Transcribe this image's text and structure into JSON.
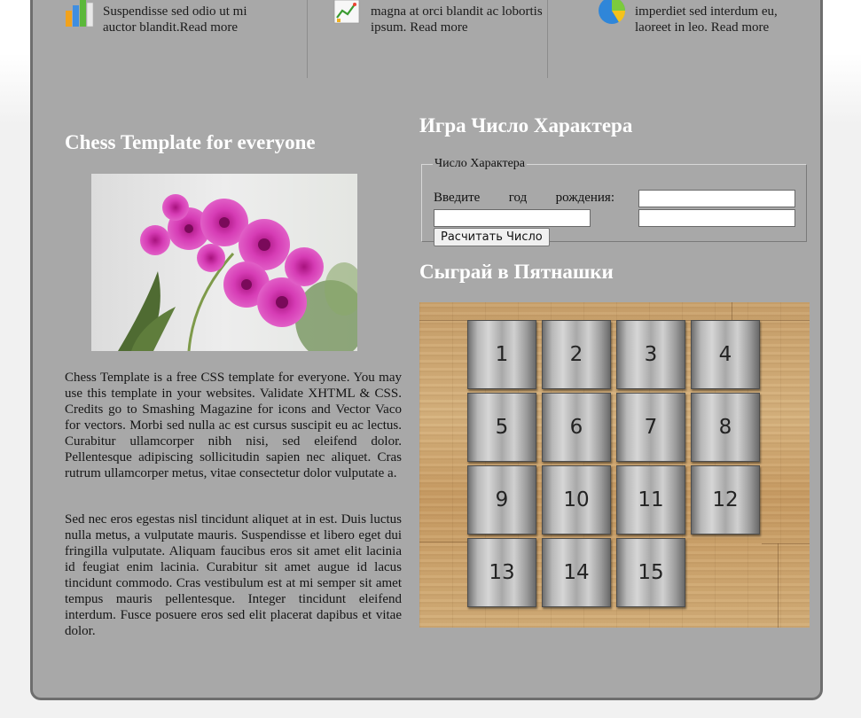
{
  "features": [
    {
      "icon": "bar-chart-icon",
      "text": "Suspendisse sed odio ut mi auctor blandit.",
      "more": "Read more"
    },
    {
      "icon": "report-chart-icon",
      "text": "magna at orci blandit ac lobortis ipsum. ",
      "more": "Read more"
    },
    {
      "icon": "pie-chart-icon",
      "text": "imperdiet sed interdum eu, laoreet in leo. ",
      "more": "Read more"
    }
  ],
  "left": {
    "title": "Chess Template for everyone",
    "paragraph1": "Chess Template is a free CSS template for everyone. You may use this template in your websites. Validate XHTML & CSS. Credits go to Smashing Magazine for icons and Vector Vaco for vectors. Morbi sed nulla ac est cursus suscipit eu ac lectus. Curabitur ullamcorper nibh nisi, sed eleifend dolor. Pellentesque adipiscing sollicitudin sapien nec aliquet. Cras rutrum ullamcorper metus, vitae consectetur dolor vulputate a.",
    "paragraph2": "Sed nec eros egestas nisl tincidunt aliquet at in est. Duis luctus nulla metus, a vulputate mauris. Suspendisse et libero eget dui fringilla vulputate. Aliquam faucibus eros sit amet elit lacinia id feugiat enim lacinia. Curabitur sit amet augue id lacus tincidunt commodo. Cras vestibulum est at mi semper sit amet tempus mauris pellentesque. Integer tincidunt eleifend interdum. Fusce posuere eros sed elit placerat dapibus et vitae dolor."
  },
  "calculator": {
    "title": "Игра Число Характера",
    "legend": "Число Характера",
    "label": "Введите год рождения:",
    "birth_year_value": "",
    "second_value": "",
    "result1_value": "",
    "result2_value": "",
    "button": "Расчитать Число"
  },
  "puzzle": {
    "title": "Сыграй в Пятнашки",
    "tiles": [
      "1",
      "2",
      "3",
      "4",
      "5",
      "6",
      "7",
      "8",
      "9",
      "10",
      "11",
      "12",
      "13",
      "14",
      "15"
    ]
  },
  "colors": {
    "panel": "#a8a8a8",
    "heading": "#ffffff",
    "orchid": "#d63cb5"
  }
}
